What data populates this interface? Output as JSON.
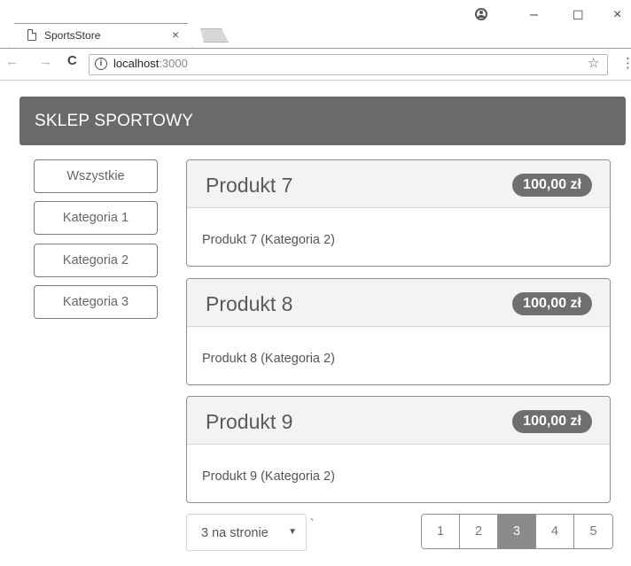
{
  "browser": {
    "tab_title": "SportsStore",
    "tab_close": "×",
    "url_host": "localhost",
    "url_port": ":3000",
    "back": "←",
    "forward": "→",
    "reload": "C",
    "info": "i",
    "star": "☆",
    "menu": "⋮",
    "minimize": "–",
    "maximize": "☐",
    "close": "×"
  },
  "navbar": {
    "brand": "SKLEP SPORTOWY"
  },
  "categories": [
    {
      "label": "Wszystkie"
    },
    {
      "label": "Kategoria 1"
    },
    {
      "label": "Kategoria 2"
    },
    {
      "label": "Kategoria 3"
    }
  ],
  "products": [
    {
      "name": "Produkt 7",
      "price": "100,00 zł",
      "description": "Produkt 7 (Kategoria 2)"
    },
    {
      "name": "Produkt 8",
      "price": "100,00 zł",
      "description": "Produkt 8 (Kategoria 2)"
    },
    {
      "name": "Produkt 9",
      "price": "100,00 zł",
      "description": "Produkt 9 (Kategoria 2)"
    }
  ],
  "per_page": {
    "selected": "3 na stronie",
    "caret": "▼",
    "tick": "`"
  },
  "pagination": {
    "pages": [
      "1",
      "2",
      "3",
      "4",
      "5"
    ],
    "active": "3"
  }
}
